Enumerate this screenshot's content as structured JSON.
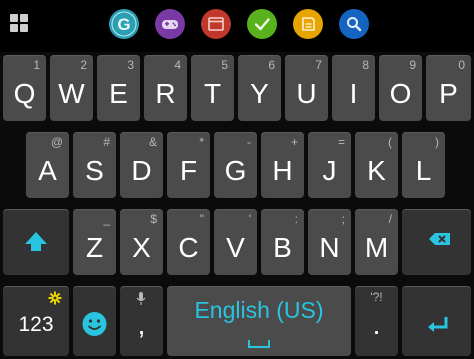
{
  "toolbar": {
    "icons": [
      {
        "name": "grammar-g-icon",
        "color": "#2a9fb1"
      },
      {
        "name": "game-controller-icon",
        "color": "#7a3aa6"
      },
      {
        "name": "browser-window-icon",
        "color": "#c0392b"
      },
      {
        "name": "checkmark-icon",
        "color": "#59b21c"
      },
      {
        "name": "notes-icon",
        "color": "#e8a400"
      },
      {
        "name": "search-icon",
        "color": "#1565c0"
      }
    ]
  },
  "keyboard": {
    "row1": [
      {
        "label": "Q",
        "hint": "1"
      },
      {
        "label": "W",
        "hint": "2"
      },
      {
        "label": "E",
        "hint": "3"
      },
      {
        "label": "R",
        "hint": "4"
      },
      {
        "label": "T",
        "hint": "5"
      },
      {
        "label": "Y",
        "hint": "6"
      },
      {
        "label": "U",
        "hint": "7"
      },
      {
        "label": "I",
        "hint": "8"
      },
      {
        "label": "O",
        "hint": "9"
      },
      {
        "label": "P",
        "hint": "0"
      }
    ],
    "row2": [
      {
        "label": "A",
        "hint": "@"
      },
      {
        "label": "S",
        "hint": "#"
      },
      {
        "label": "D",
        "hint": "&"
      },
      {
        "label": "F",
        "hint": "*"
      },
      {
        "label": "G",
        "hint": "-"
      },
      {
        "label": "H",
        "hint": "+"
      },
      {
        "label": "J",
        "hint": "="
      },
      {
        "label": "K",
        "hint": "("
      },
      {
        "label": "L",
        "hint": ")"
      }
    ],
    "row3": [
      {
        "label": "Z",
        "hint": "_"
      },
      {
        "label": "X",
        "hint": "$"
      },
      {
        "label": "C",
        "hint": "\""
      },
      {
        "label": "V",
        "hint": "'"
      },
      {
        "label": "B",
        "hint": ":"
      },
      {
        "label": "N",
        "hint": ";"
      },
      {
        "label": "M",
        "hint": "/"
      }
    ],
    "symbols_label": "123",
    "comma_label": ",",
    "space_label": "English (US)",
    "period_label": ".",
    "period_hint": "'?!",
    "accent_color": "#29c4df"
  }
}
